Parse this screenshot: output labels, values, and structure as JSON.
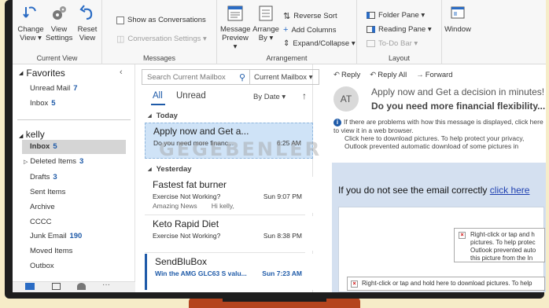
{
  "ribbon": {
    "current_view": {
      "group_label": "Current View",
      "change_view": "Change View ▾",
      "view_settings": "View Settings",
      "reset_view": "Reset View"
    },
    "messages": {
      "group_label": "Messages",
      "show_as_conversations": "Show as Conversations",
      "conversation_settings": "Conversation Settings ▾"
    },
    "arrangement": {
      "group_label": "Arrangement",
      "message_preview": "Message Preview ▾",
      "arrange_by": "Arrange By ▾",
      "reverse_sort": "Reverse Sort",
      "add_columns": "Add Columns",
      "expand_collapse": "Expand/Collapse ▾"
    },
    "layout": {
      "group_label": "Layout",
      "folder_pane": "Folder Pane ▾",
      "reading_pane": "Reading Pane ▾",
      "to_do_bar": "To-Do Bar ▾"
    },
    "window": {
      "label": "Window"
    }
  },
  "folder_pane": {
    "favorites_label": "Favorites",
    "favorites": [
      {
        "name": "Unread Mail",
        "count": "7"
      },
      {
        "name": "Inbox",
        "count": "5"
      }
    ],
    "account_label": "kelly",
    "folders": [
      {
        "name": "Inbox",
        "count": "5"
      },
      {
        "name": "Deleted Items",
        "count": "3"
      },
      {
        "name": "Drafts",
        "count": "3"
      },
      {
        "name": "Sent Items",
        "count": ""
      },
      {
        "name": "Archive",
        "count": ""
      },
      {
        "name": "CCCC",
        "count": ""
      },
      {
        "name": "Junk Email",
        "count": "190"
      },
      {
        "name": "Moved Items",
        "count": ""
      },
      {
        "name": "Outbox",
        "count": ""
      }
    ]
  },
  "message_list": {
    "search_placeholder": "Search Current Mailbox",
    "scope": "Current Mailbox ▾",
    "tab_all": "All",
    "tab_unread": "Unread",
    "sort_by": "By Date ▾",
    "sort_arrow": "↑",
    "groups": [
      {
        "label": "Today",
        "messages": [
          {
            "from": "Apply now and Get a...",
            "subject": "Do you need more financ...",
            "time": "6:25 AM",
            "preview": ""
          }
        ]
      },
      {
        "label": "Yesterday",
        "messages": [
          {
            "from": "Fastest fat burner",
            "subject": "Exercise Not Working?",
            "time": "Sun 9:07 PM",
            "preview_a": "Amazing News",
            "preview_b": "Hi kelly,"
          },
          {
            "from": "Keto Rapid Diet",
            "subject": "Exercise Not Working?",
            "time": "Sun 8:38 PM",
            "preview": ""
          },
          {
            "from": "SendBluBox",
            "subject": "Win the AMG GLC63 S valu...",
            "time": "Sun 7:23 AM",
            "preview": ""
          }
        ]
      }
    ]
  },
  "reading_pane": {
    "reply": "Reply",
    "reply_all": "Reply All",
    "forward": "Forward",
    "avatar_initials": "AT",
    "sender_line": "Apply now and Get a decision in minutes!",
    "subject_line": "Do you need more financial flexibility...",
    "info_line_1": "If there are problems with how this message is displayed, click here to view it in a web browser.",
    "info_line_2": "Click here to download pictures. To help protect your privacy, Outlook prevented automatic download of some pictures in",
    "body_notice": "If you do not see the email correctly",
    "body_link": "click here",
    "img_placeholder_1": "Right-click or tap and h pictures. To help protec Outlook prevented auto this picture from the In",
    "img_placeholder_2": "Right-click or tap and hold here to download pictures. To help"
  },
  "watermark": "GEGEBENLER"
}
